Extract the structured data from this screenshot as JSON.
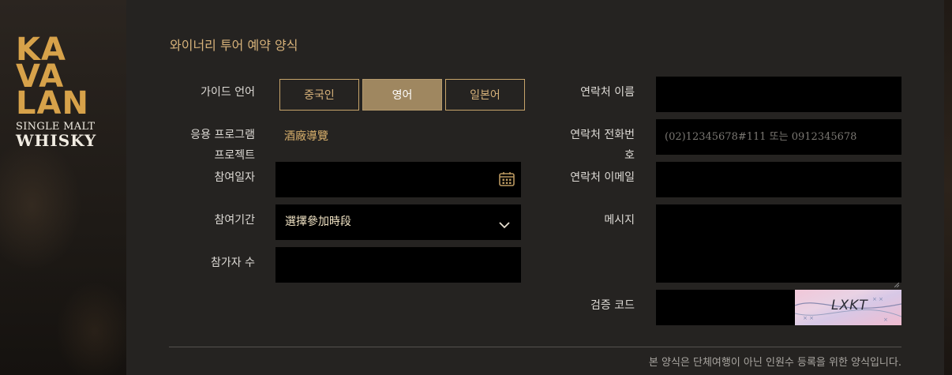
{
  "brand": {
    "logo_lines": [
      "KA",
      "VA",
      "LAN"
    ],
    "subtitle": "SINGLE MALT",
    "product": "WHISKY"
  },
  "form": {
    "title": "와이너리 투어 예약 양식",
    "guide_language": {
      "label": "가이드 언어",
      "options": [
        "중국인",
        "영어",
        "일본어"
      ],
      "selected": "영어"
    },
    "app_project": {
      "label_line1": "응용 프로그램",
      "label_line2": "프로젝트",
      "value": "酒廠導覽"
    },
    "participation_date": {
      "label": "참여일자",
      "value": ""
    },
    "participation_period": {
      "label": "참여기간",
      "selected": "選擇參加時段"
    },
    "participants": {
      "label": "참가자 수",
      "value": ""
    },
    "contact_name": {
      "label": "연락처 이름",
      "value": ""
    },
    "contact_phone": {
      "label_line1": "연락처 전화번",
      "label_line2": "호",
      "placeholder": "(02)12345678#111 또는 0912345678"
    },
    "contact_email": {
      "label": "연락처 이메일",
      "value": ""
    },
    "message": {
      "label": "메시지",
      "value": ""
    },
    "captcha": {
      "label": "검증 코드",
      "code": "LXKT"
    },
    "footer_note": "본 양식은 단체여행이 아닌 인원수 등록을 위한 양식입니다."
  },
  "colors": {
    "accent": "#d7b27a",
    "active_button": "#9f8760",
    "panel_bg": "#252321",
    "field_bg": "#000000"
  }
}
